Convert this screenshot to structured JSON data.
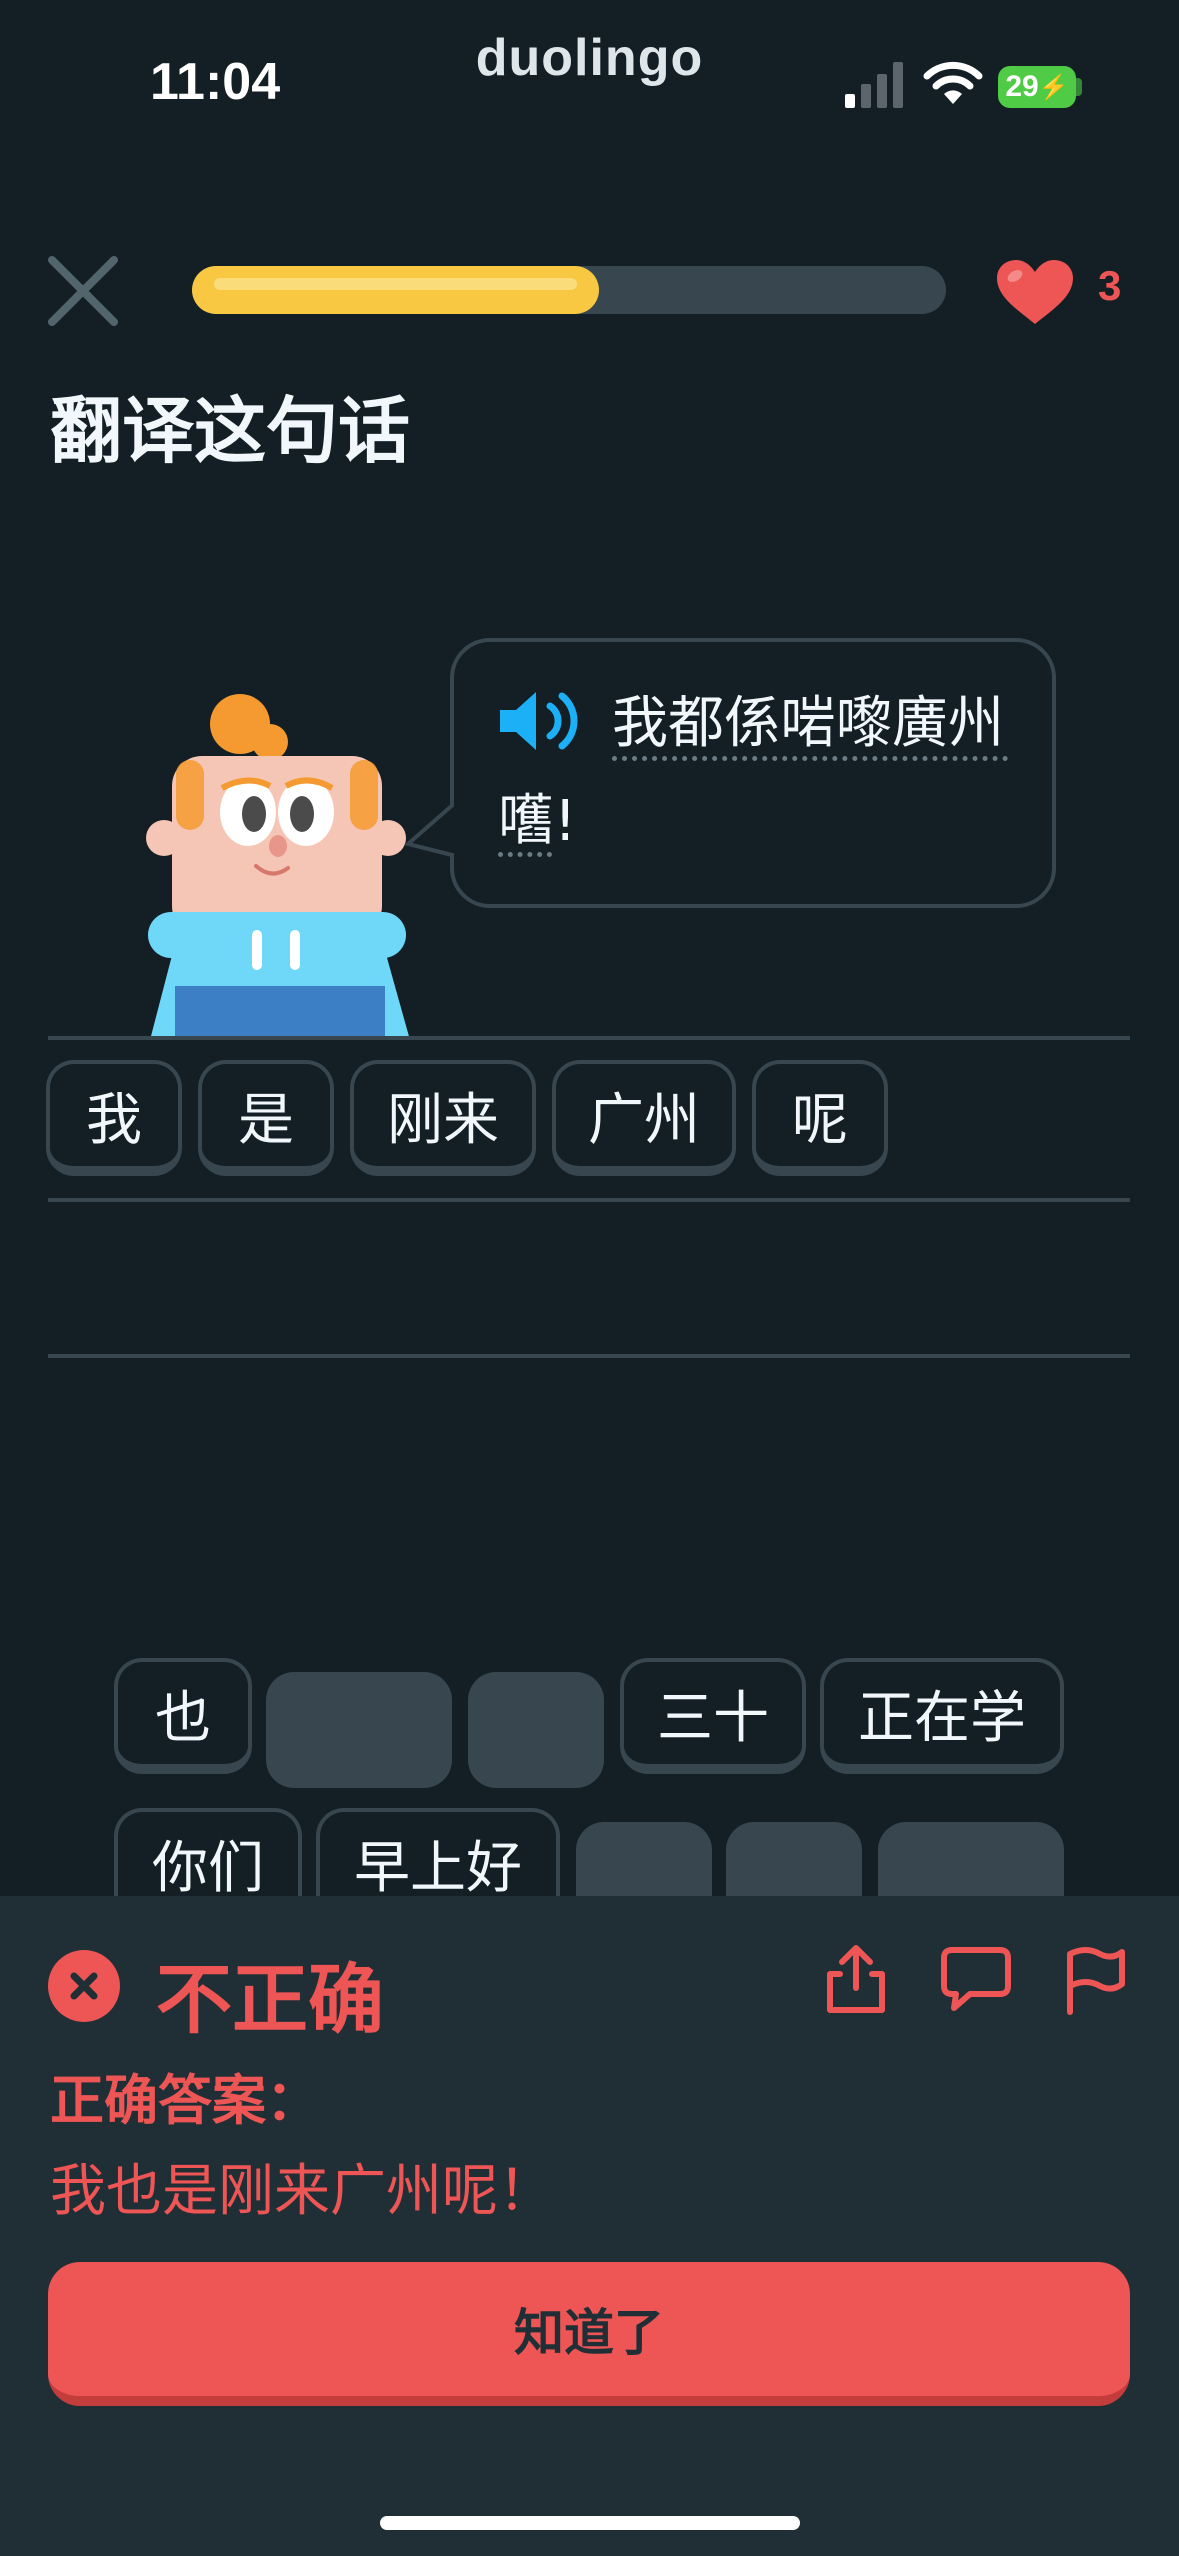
{
  "status_bar": {
    "time": "11:04",
    "app_brand": "duolingo",
    "battery": "29"
  },
  "lesson": {
    "progress_percent": 54,
    "hearts": "3",
    "prompt_title": "翻译这句话"
  },
  "speech_bubble": {
    "line1": "我都係啱嚟廣州",
    "line2": "嚿!"
  },
  "answer_tiles": [
    "我",
    "是",
    "刚来",
    "广州",
    "呢"
  ],
  "word_bank": {
    "row1": [
      {
        "label": "也",
        "used": false
      },
      {
        "label": "",
        "used": true
      },
      {
        "label": "",
        "used": true
      },
      {
        "label": "三十",
        "used": false
      },
      {
        "label": "正在学",
        "used": false
      }
    ],
    "row2": [
      {
        "label": "你们",
        "used": false
      },
      {
        "label": "早上好",
        "used": false
      },
      {
        "label": "",
        "used": true
      },
      {
        "label": "",
        "used": true
      },
      {
        "label": "",
        "used": true
      }
    ]
  },
  "feedback": {
    "title": "不正确",
    "answer_label": "正确答案：",
    "correct_answer": "我也是刚来广州呢！",
    "continue_label": "知道了"
  },
  "colors": {
    "background": "#131f24",
    "panel": "#202f36",
    "error": "#ee5555",
    "progress": "#f8c843",
    "tile_border": "#37464f",
    "speaker": "#1cb0f6"
  }
}
